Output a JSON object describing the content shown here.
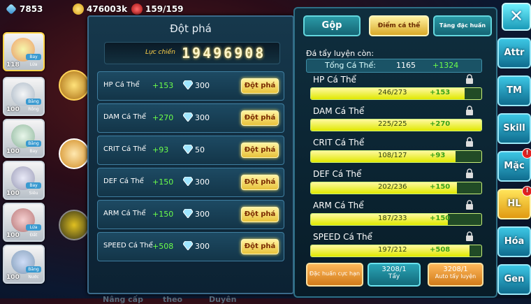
{
  "topbar": {
    "gems": "7853",
    "gold": "476003k",
    "energy": "159/159"
  },
  "roster": [
    {
      "level": "118",
      "tag": "Lửa",
      "color": "#e04a2a"
    },
    {
      "level": "100",
      "tag": "Rồng",
      "color": "#3a6ad0"
    },
    {
      "level": "100",
      "tag": "Bay",
      "color": "#47a0d8"
    },
    {
      "level": "100",
      "tag": "Siêu",
      "color": "#b03ad0"
    },
    {
      "level": "100",
      "tag": "Đất",
      "color": "#c0802a"
    },
    {
      "level": "100",
      "tag": "Nước",
      "color": "#2a8ad8"
    }
  ],
  "breakthrough": {
    "title": "Đột phá",
    "power_label": "Lực chiến",
    "power_value": "19496908",
    "button_label": "Đột phá",
    "rows": [
      {
        "name": "HP Cá Thể",
        "plus": "+153",
        "cost": "300"
      },
      {
        "name": "DAM Cá Thể",
        "plus": "+270",
        "cost": "300"
      },
      {
        "name": "CRIT Cá Thể",
        "plus": "+93",
        "cost": "50"
      },
      {
        "name": "DEF Cá Thể",
        "plus": "+150",
        "cost": "300"
      },
      {
        "name": "ARM Cá Thể",
        "plus": "+150",
        "cost": "300"
      },
      {
        "name": "SPEED Cá Thể",
        "plus": "+508",
        "cost": "300"
      }
    ]
  },
  "training": {
    "tabs": [
      "Gộp",
      "Điểm cá thể",
      "Tăng đặc huấn"
    ],
    "subtitle": "Đá tẩy luyện còn:",
    "total_label": "Tổng Cá Thể:",
    "total_value": "1165",
    "total_bonus": "+1324",
    "stats": [
      {
        "name": "HP Cá Thể",
        "current": 246,
        "max": 273,
        "text": "246/273",
        "bonus": "+153"
      },
      {
        "name": "DAM Cá Thể",
        "current": 225,
        "max": 225,
        "text": "225/225",
        "bonus": "+270"
      },
      {
        "name": "CRIT Cá Thể",
        "current": 108,
        "max": 127,
        "text": "108/127",
        "bonus": "+93"
      },
      {
        "name": "DEF Cá Thể",
        "current": 202,
        "max": 236,
        "text": "202/236",
        "bonus": "+150"
      },
      {
        "name": "ARM Cá Thể",
        "current": 187,
        "max": 233,
        "text": "187/233",
        "bonus": "+150"
      },
      {
        "name": "SPEED Cá Thể",
        "current": 197,
        "max": 212,
        "text": "197/212",
        "bonus": "+508"
      }
    ],
    "footer": {
      "special_label": "Đặc huấn cực hạn",
      "wash_count": "3208/1",
      "wash_label": "Tẩy",
      "auto_count": "3208/1",
      "auto_label": "Auto tẩy luyện"
    }
  },
  "sidenav": [
    {
      "label": "Attr",
      "badge": false
    },
    {
      "label": "TM",
      "badge": false
    },
    {
      "label": "Skill",
      "badge": false
    },
    {
      "label": "Mặc",
      "badge": true
    },
    {
      "label": "HL",
      "badge": true
    },
    {
      "label": "Hóa",
      "badge": false
    },
    {
      "label": "Gen",
      "badge": false
    }
  ],
  "close_label": "✕",
  "ghost_tabs": [
    "Nâng cấp",
    "theo",
    "Duyên"
  ]
}
